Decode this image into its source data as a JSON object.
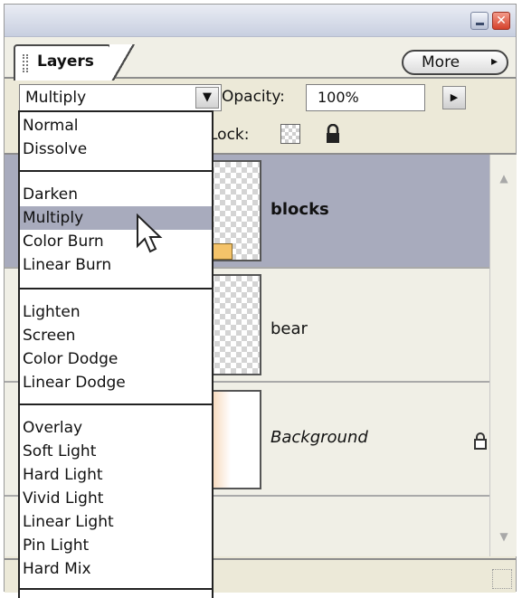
{
  "panel": {
    "tab_label": "Layers",
    "more_label": "More",
    "more_arrow": "▸",
    "close_glyph": "✕"
  },
  "options": {
    "blend_mode": "Multiply",
    "opacity_label": "Opacity:",
    "opacity_value": "100%",
    "lock_label": "Lock:"
  },
  "blend_modes": {
    "groups": [
      [
        "Normal",
        "Dissolve"
      ],
      [
        "Darken",
        "Multiply",
        "Color Burn",
        "Linear Burn"
      ],
      [
        "Lighten",
        "Screen",
        "Color Dodge",
        "Linear Dodge"
      ],
      [
        "Overlay",
        "Soft Light",
        "Hard Light",
        "Vivid Light",
        "Linear Light",
        "Pin Light",
        "Hard Mix"
      ]
    ],
    "highlighted": "Multiply"
  },
  "layers": [
    {
      "name": "blocks",
      "selected": true,
      "style": "bold"
    },
    {
      "name": "bear",
      "selected": false,
      "style": "normal"
    },
    {
      "name": "Background",
      "selected": false,
      "style": "italic",
      "locked": true
    }
  ],
  "colors": {
    "selection": "#a8abbd",
    "panel_bg": "#ece9d8"
  }
}
